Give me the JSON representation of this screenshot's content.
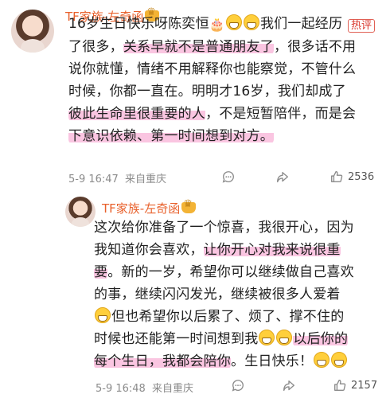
{
  "comment1": {
    "username": "TF家族-左奇函",
    "hot_badge": "热评",
    "lines": [
      [
        "16岁生日快乐呀陈奕恒",
        "🎂",
        "😁😁",
        "我们一起经历"
      ],
      [
        "了很多，",
        "关系早就不是普通朋友了",
        "，很多话不用"
      ],
      [
        "说你就懂，情绪不用解释你也能察觉，不管什么"
      ],
      [
        "时候，你都一直在。明明才16岁，我们却成了"
      ],
      [
        "彼此生命里很重要的人",
        "，不是短暂陪伴，而是会"
      ],
      [
        "下意识依赖、第一时间想到对方。"
      ]
    ],
    "date": "5-9 16:47",
    "location": "来自重庆",
    "likes": "2536"
  },
  "comment2": {
    "username": "TF家族-左奇函",
    "lines": [
      [
        "这次给你准备了一个惊喜，我很开心，因为"
      ],
      [
        "我知道你会喜欢，",
        "让你开心对我来说很重"
      ],
      [
        "要",
        "。新的一岁，希望你可以继续做自己喜欢"
      ],
      [
        "的事，继续闪闪发光，继续被很多人爱着"
      ],
      [
        "但也希望你以后累了、烦了、撑不住的"
      ],
      [
        "时候也还能第一时间想到我",
        "以后你的"
      ],
      [
        "每个生日，我都会陪你",
        "。生日快乐！"
      ]
    ],
    "date": "5-9 16:48",
    "location": "来自重庆",
    "likes": "2157"
  }
}
